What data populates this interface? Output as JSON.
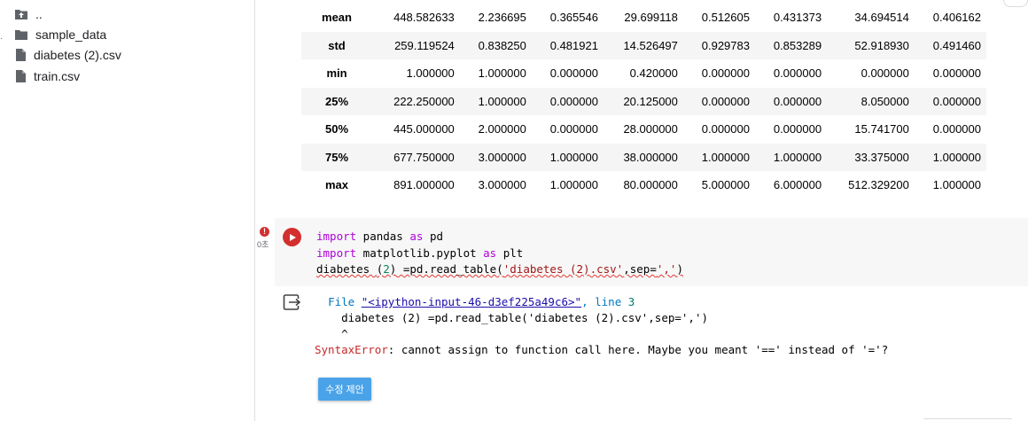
{
  "sidebar": {
    "items": [
      {
        "label": "..",
        "icon": "folder-up-icon"
      },
      {
        "label": "sample_data",
        "icon": "folder-icon"
      },
      {
        "label": "diabetes (2).csv",
        "icon": "file-icon"
      },
      {
        "label": "train.csv",
        "icon": "file-icon"
      }
    ]
  },
  "table": {
    "rows": [
      {
        "label": "mean",
        "values": [
          "448.582633",
          "2.236695",
          "0.365546",
          "29.699118",
          "0.512605",
          "0.431373",
          "34.694514",
          "0.406162"
        ]
      },
      {
        "label": "std",
        "values": [
          "259.119524",
          "0.838250",
          "0.481921",
          "14.526497",
          "0.929783",
          "0.853289",
          "52.918930",
          "0.491460"
        ]
      },
      {
        "label": "min",
        "values": [
          "1.000000",
          "1.000000",
          "0.000000",
          "0.420000",
          "0.000000",
          "0.000000",
          "0.000000",
          "0.000000"
        ]
      },
      {
        "label": "25%",
        "values": [
          "222.250000",
          "1.000000",
          "0.000000",
          "20.125000",
          "0.000000",
          "0.000000",
          "8.050000",
          "0.000000"
        ]
      },
      {
        "label": "50%",
        "values": [
          "445.000000",
          "2.000000",
          "0.000000",
          "28.000000",
          "0.000000",
          "0.000000",
          "15.741700",
          "0.000000"
        ]
      },
      {
        "label": "75%",
        "values": [
          "677.750000",
          "3.000000",
          "1.000000",
          "38.000000",
          "1.000000",
          "1.000000",
          "33.375000",
          "1.000000"
        ]
      },
      {
        "label": "max",
        "values": [
          "891.000000",
          "3.000000",
          "1.000000",
          "80.000000",
          "5.000000",
          "6.000000",
          "512.329200",
          "1.000000"
        ]
      }
    ]
  },
  "cell": {
    "exec_time": "0초",
    "error_badge": "!",
    "code": {
      "line1": {
        "kw1": "import",
        "mid": " pandas ",
        "kw2": "as",
        "rest": " pd"
      },
      "line2": {
        "kw1": "import",
        "mid": " matplotlib.pyplot ",
        "kw2": "as",
        "rest": " plt"
      },
      "line3": {
        "a": "diabetes ",
        "b": "(",
        "c": "2",
        "d": ")",
        "e": " =pd.read_table(",
        "f": "'diabetes (2).csv'",
        "g": ",sep=",
        "h": "','",
        "i": ")"
      }
    }
  },
  "output": {
    "file_kw": "File",
    "file_link": "\"<ipython-input-46-d3ef225a49c6>\"",
    "line_kw": ", line ",
    "line_num": "3",
    "src_line": "    diabetes (2) =pd.read_table('diabetes (2).csv',sep=',')",
    "caret": "    ^",
    "error_name": "SyntaxError",
    "error_text": ": cannot assign to function call here. Maybe you meant '==' instead of '='?",
    "fix_button": "수정 제안"
  },
  "colors": {
    "run_button": "#d32f2f",
    "fix_button": "#4aa3e8",
    "keyword": "#af00db",
    "string": "#a31515",
    "error": "#c62828"
  }
}
